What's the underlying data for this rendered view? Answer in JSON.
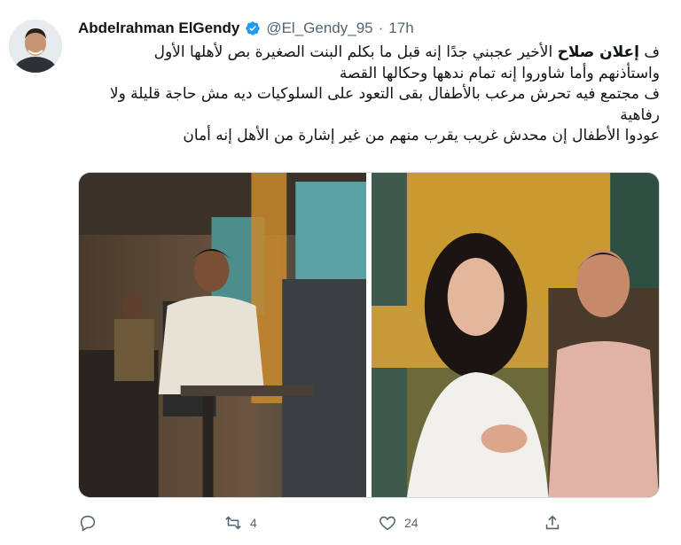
{
  "user": {
    "display_name": "Abdelrahman ElGendy",
    "handle": "@El_Gendy_95",
    "separator": "·",
    "time": "17h",
    "verified": true,
    "avatar_icon": "avatar-photo"
  },
  "tweet": {
    "line1_prefix": "ف ",
    "line1_bold": "إعلان صلاح",
    "line1_rest": " الأخير عجبني جدًا إنه قبل ما بكلم البنت الصغيرة بص لأهلها الأول",
    "line2": "واستأذنهم وأما شاوروا إنه تمام ندهها وحكالها القصة",
    "line3": "ف مجتمع فيه تحرش مرعب بالأطفال بقى التعود على السلوكيات ديه مش حاجة قليلة ولا رفاهية",
    "line4": "عودوا الأطفال إن محدش غريب يقرب منهم من غير إشارة من الأهل إنه أمان"
  },
  "media": {
    "images": [
      {
        "name": "train-photo-left",
        "subject": "man sitting in train seat"
      },
      {
        "name": "train-photo-right",
        "subject": "woman and man sitting in train"
      }
    ]
  },
  "actions": {
    "reply_count": "",
    "retweet_count": "4",
    "like_count": "24",
    "icons": [
      "reply-icon",
      "retweet-icon",
      "like-icon",
      "share-icon"
    ]
  },
  "colors": {
    "verified": "#1d9bf0",
    "secondary_text": "#536471",
    "primary_text": "#0f1419"
  }
}
